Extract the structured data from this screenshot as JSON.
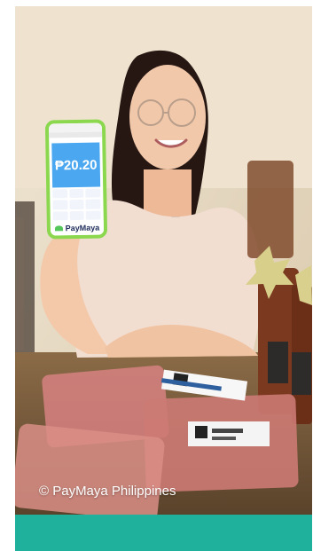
{
  "photo": {
    "caption": "© PayMaya Philippines",
    "phone_screen_amount": "₱20.20",
    "phone_brand": "PayMaya"
  },
  "colors": {
    "accent_bar": "#20b19c",
    "phone_case": "#8bd84f",
    "phone_screen": "#4aa7f0",
    "background": "#e8ddc7"
  }
}
